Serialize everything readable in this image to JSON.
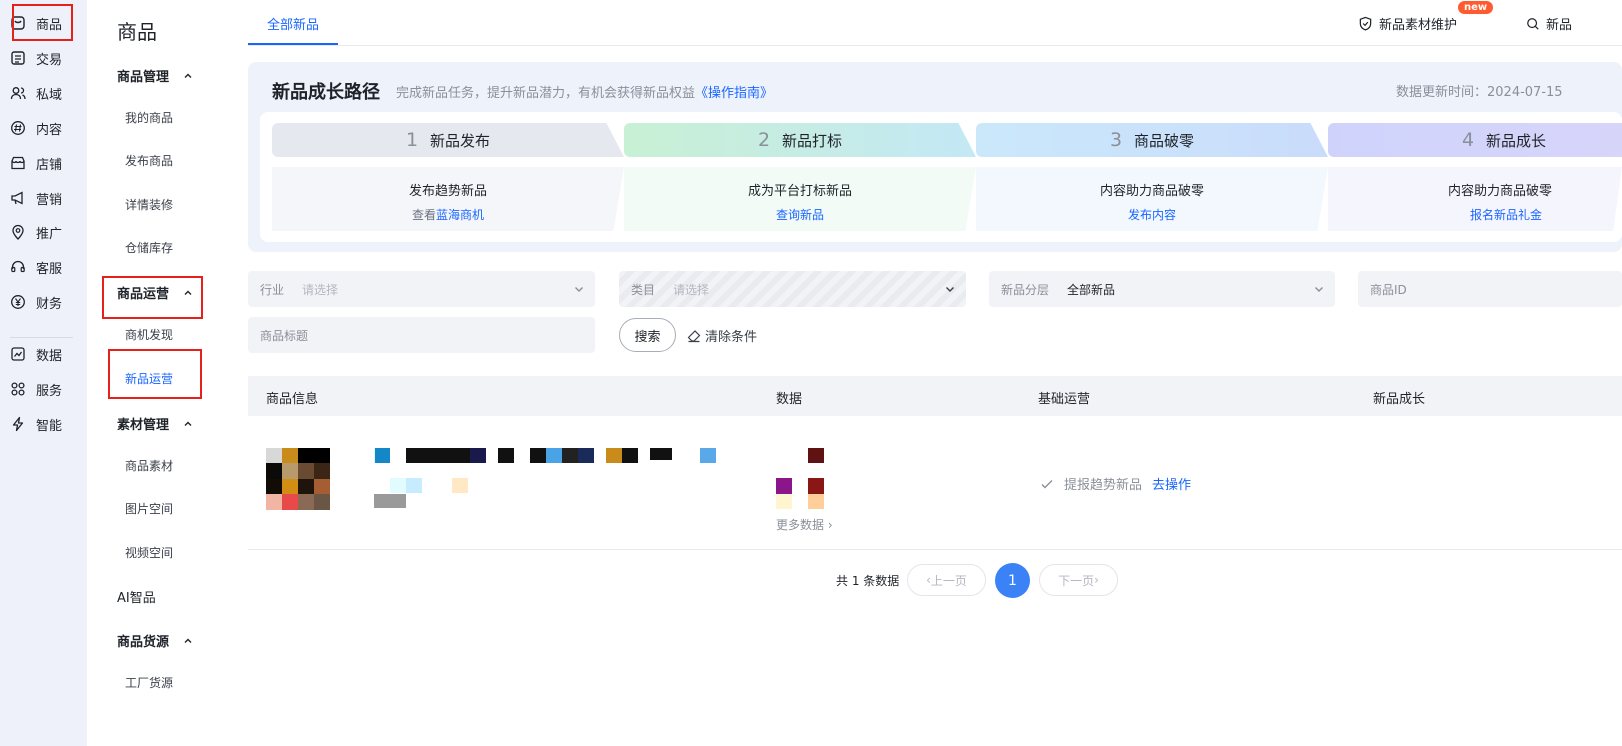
{
  "rail": {
    "items": [
      {
        "label": "商品",
        "icon": "product-icon"
      },
      {
        "label": "交易",
        "icon": "order-icon"
      },
      {
        "label": "私域",
        "icon": "users-icon"
      },
      {
        "label": "内容",
        "icon": "hash-icon"
      },
      {
        "label": "店铺",
        "icon": "store-icon"
      },
      {
        "label": "营销",
        "icon": "megaphone-icon"
      },
      {
        "label": "推广",
        "icon": "location-icon"
      },
      {
        "label": "客服",
        "icon": "headset-icon"
      },
      {
        "label": "财务",
        "icon": "yuan-icon"
      },
      {
        "label": "数据",
        "icon": "chart-icon"
      },
      {
        "label": "服务",
        "icon": "grid-icon"
      },
      {
        "label": "智能",
        "icon": "bolt-icon"
      }
    ]
  },
  "subnav": {
    "title": "商品",
    "groups": [
      {
        "label": "商品管理",
        "items": [
          "我的商品",
          "发布商品",
          "详情装修",
          "仓储库存"
        ]
      },
      {
        "label": "商品运营",
        "items": [
          "商机发现",
          "新品运营"
        ]
      },
      {
        "label": "素材管理",
        "items": [
          "商品素材",
          "图片空间",
          "视频空间"
        ]
      },
      {
        "label": "AI智品",
        "items": []
      },
      {
        "label": "商品货源",
        "items": [
          "工厂货源"
        ]
      }
    ]
  },
  "topbar": {
    "tab": "全部新品",
    "maintain": "新品素材维护",
    "badge": "new",
    "search": "新品"
  },
  "growth": {
    "title": "新品成长路径",
    "desc": "完成新品任务，提升新品潜力，有机会获得新品权益",
    "guide": "《操作指南》",
    "update": "数据更新时间：2024-07-15",
    "steps": [
      {
        "num": "1",
        "name": "新品发布",
        "task": "发布趋势新品",
        "link_pre": "查看",
        "link": "蓝海商机"
      },
      {
        "num": "2",
        "name": "新品打标",
        "task": "成为平台打标新品",
        "link_pre": "",
        "link": "查询新品"
      },
      {
        "num": "3",
        "name": "商品破零",
        "task": "内容助力商品破零",
        "link_pre": "",
        "link": "发布内容"
      },
      {
        "num": "4",
        "name": "新品成长",
        "task": "内容助力商品破零",
        "link_pre": "",
        "link": "报名新品礼金"
      }
    ]
  },
  "filters": {
    "industry": {
      "label": "行业",
      "value": "请选择"
    },
    "category": {
      "label": "类目",
      "value": "请选择"
    },
    "tier": {
      "label": "新品分层",
      "value": "全部新品"
    },
    "product_id": {
      "placeholder": "商品ID"
    },
    "title": {
      "placeholder": "商品标题"
    },
    "search_btn": "搜索",
    "clear_btn": "清除条件"
  },
  "table": {
    "headers": [
      "商品信息",
      "数据",
      "基础运营",
      "新品成长"
    ],
    "row": {
      "op_text": "提报趋势新品",
      "op_link": "去操作",
      "more": "更多数据"
    }
  },
  "pager": {
    "total": "共 1 条数据",
    "prev": "上一页",
    "current": "1",
    "next": "下一页"
  }
}
